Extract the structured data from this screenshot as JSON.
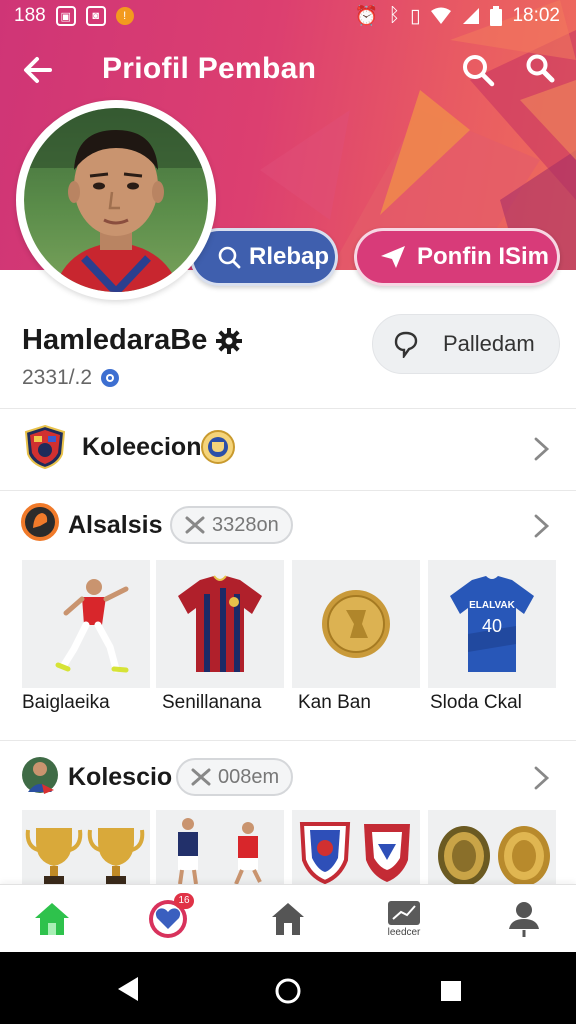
{
  "status_bar": {
    "left_text": "188",
    "time": "18:02",
    "notification_icons": [
      "gallery-icon",
      "ghost-icon",
      "alert-icon"
    ],
    "system_icons": [
      "alarm-icon",
      "bluetooth-icon",
      "vibrate-icon",
      "wifi-icon",
      "signal-icon",
      "battery-icon"
    ]
  },
  "app_bar": {
    "title": "Priofil Pemban",
    "icons": [
      "back-arrow-icon",
      "search-icon",
      "search-icon"
    ]
  },
  "profile": {
    "chat_button_label": "Rlebap",
    "share_button_label": "Ponfin ISim",
    "name": "HamledaraBe",
    "user_id": "2331/.2",
    "message_button_label": "Palledam"
  },
  "sections": [
    {
      "title": "Koleecion",
      "icon": "club-crest-icon",
      "trailing_icon": "trophy-badge-icon"
    },
    {
      "title": "Alsalsis",
      "icon": "orange-ring-icon",
      "badge": "3328on",
      "items": [
        {
          "label": "Baiglaeika",
          "image": "player-kicking"
        },
        {
          "label": "Senillanana",
          "image": "red-striped-jersey"
        },
        {
          "label": "Kan Ban",
          "image": "gold-coin"
        },
        {
          "label": "Sloda Ckal",
          "image": "blue-jersey"
        }
      ]
    },
    {
      "title": "Kolescio",
      "icon": "player-avatar-icon",
      "badge": "008em",
      "items": [
        {
          "label": "",
          "image": "trophies"
        },
        {
          "label": "",
          "image": "players"
        },
        {
          "label": "",
          "image": "club-badges"
        },
        {
          "label": "",
          "image": "medals"
        }
      ]
    }
  ],
  "jersey_number": "40",
  "jersey_text": "ELALVAK",
  "bottom_nav": {
    "items": [
      {
        "icon": "home-icon",
        "label": ""
      },
      {
        "icon": "heart-icon",
        "label": "",
        "badge": "16"
      },
      {
        "icon": "house-icon",
        "label": ""
      },
      {
        "icon": "chart-icon",
        "label": "leedcer"
      },
      {
        "icon": "profile-icon",
        "label": ""
      }
    ]
  },
  "colors": {
    "hero_start": "#cf3576",
    "hero_end": "#ef6d5b",
    "blue_pill": "#3f5fae",
    "pink_pill": "#d83b79",
    "active_nav": "#2ec24c"
  }
}
